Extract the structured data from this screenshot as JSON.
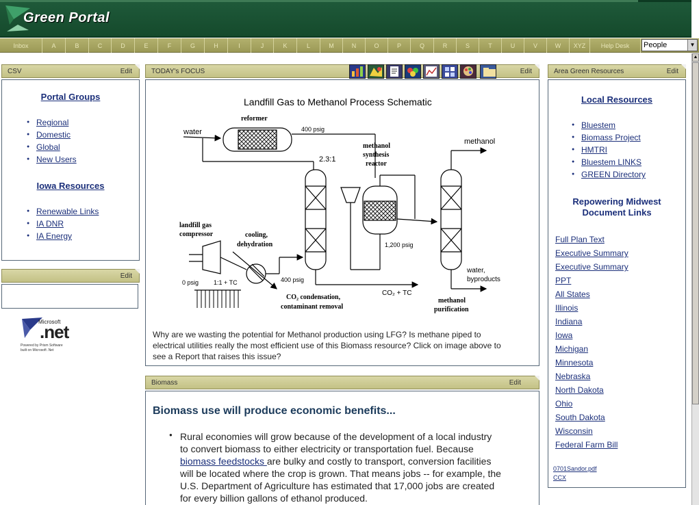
{
  "header": {
    "logo_text": "Green Portal"
  },
  "nav": {
    "items": [
      "Inbox",
      "A",
      "B",
      "C",
      "D",
      "E",
      "F",
      "G",
      "H",
      "I",
      "J",
      "K",
      "L",
      "M",
      "N",
      "O",
      "P",
      "Q",
      "R",
      "S",
      "T",
      "U",
      "V",
      "W",
      "XYZ",
      "Help Desk"
    ],
    "people_select": "People"
  },
  "left": {
    "csv_title": "CSV",
    "edit": "Edit",
    "portal_groups_title": "Portal Groups",
    "portal_groups": [
      "Regional",
      "Domestic",
      "Global",
      "New Users"
    ],
    "iowa_title": "Iowa Resources",
    "iowa_links": [
      "Renewable Links",
      "IA DNR",
      "IA Energy"
    ],
    "empty_edit": "Edit",
    "dotnet_brand": "Microsoft",
    "dotnet_net": ".net",
    "dotnet_caption_1": "Powered by Prism Software",
    "dotnet_caption_2": "built on Microsoft .Net"
  },
  "focus": {
    "title": "TODAY's FOCUS",
    "edit": "Edit",
    "toolbar_icons": [
      "chart-icon",
      "map-icon",
      "doc-icon",
      "color-wheel-icon",
      "graph-icon",
      "grid-icon",
      "palette-icon",
      "folder-icon"
    ],
    "schematic": {
      "title": "Landfill Gas to Methanol Process Schematic",
      "water": "water",
      "reformer": "reformer",
      "p400": "400 psig",
      "ratio": "2.3:1",
      "methanol_synth_1": "methanol",
      "methanol_synth_2": "synthesis",
      "methanol_synth_3": "reactor",
      "methanol_out": "methanol",
      "landfill_1": "landfill gas",
      "landfill_2": "compressor",
      "cooling_1": "cooling,",
      "cooling_2": "dehydration",
      "p0": "0 psig",
      "ratio2": "1:1 + TC",
      "p400b": "400 psig",
      "p1200": "1,200 psig",
      "water_by_1": "water,",
      "water_by_2": "byproducts",
      "co2_1": "CO₂ condensation,",
      "co2_2": "contaminant removal",
      "co2tc": "CO₂ + TC",
      "purif_1": "methanol",
      "purif_2": "purification"
    },
    "caption_1": "Why are we wasting the potential for Methanol production using LFG? Is methane piped to",
    "caption_2": "electrical utilities really the most efficient use of this Biomass resource? Click on image above to",
    "caption_3": "see a Report that raises this issue?"
  },
  "biomass": {
    "title": "Biomass",
    "edit": "Edit",
    "heading": "Biomass use will produce economic benefits...",
    "line_1": "Rural economies will grow because of the development of a local industry",
    "line_2": "to convert biomass to either electricity or transportation fuel. Because",
    "line_3_link": "biomass feedstocks ",
    "line_3_rest": "are bulky and costly to transport, conversion facilities",
    "line_4": "will be located where the crop is grown. That means jobs -- for example, the",
    "line_5": "U.S. Department of Agriculture has estimated that 17,000 jobs are created",
    "line_6": "for every billion gallons of ethanol produced."
  },
  "right": {
    "title": "Area Green Resources",
    "edit": "Edit",
    "local_title": "Local Resources",
    "local_links": [
      "Bluestem",
      "Biomass Project",
      "HMTRI",
      "Bluestem LINKS",
      "GREEN Directory"
    ],
    "repower_1": "Repowering Midwest",
    "repower_2": "Document Links",
    "doc_links": [
      "Full Plan Text",
      "Executive Summary",
      "Executive Summary",
      "PPT",
      "All States",
      "Illinois",
      "Indiana",
      "Iowa",
      "Michigan",
      "Minnesota",
      "Nebraska",
      "North Dakota",
      "Ohio",
      "South Dakota",
      "Wisconsin",
      "Federal Farm Bill"
    ],
    "file_1": "0701Sandor.pdf",
    "file_2": "CCX"
  }
}
